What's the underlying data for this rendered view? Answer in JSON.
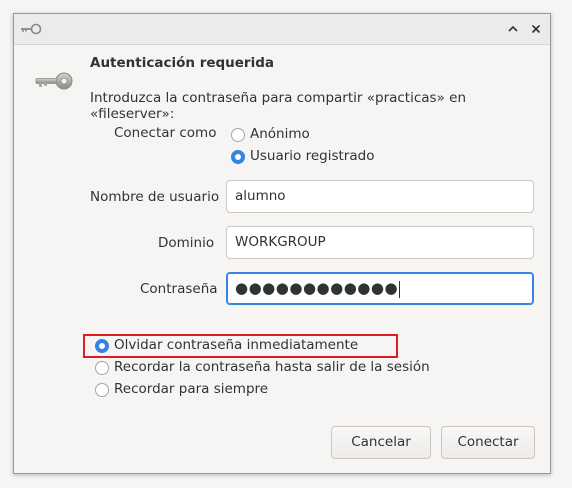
{
  "dialog": {
    "title": "Autenticación requerida",
    "description": "Introduzca la contraseña para compartir «practicas» en «fileserver»:"
  },
  "connect_as": {
    "label": "Conectar como",
    "options": [
      {
        "label": "Anónimo",
        "selected": false
      },
      {
        "label": "Usuario registrado",
        "selected": true
      }
    ]
  },
  "fields": {
    "username": {
      "label": "Nombre de usuario",
      "value": "alumno"
    },
    "domain": {
      "label": "Dominio",
      "value": "WORKGROUP"
    },
    "password": {
      "label": "Contraseña",
      "value": "●●●●●●●●●●●●"
    }
  },
  "remember": {
    "options": [
      {
        "label": "Olvidar contraseña inmediatamente",
        "selected": true
      },
      {
        "label": "Recordar la contraseña hasta salir de la sesión",
        "selected": false
      },
      {
        "label": "Recordar para siempre",
        "selected": false
      }
    ]
  },
  "buttons": {
    "cancel": "Cancelar",
    "connect": "Conectar"
  },
  "titlebar": {
    "minimize_icon": "chevron-up-icon",
    "close_icon": "close-icon"
  },
  "colors": {
    "accent": "#3584e4",
    "highlight": "#e01b24"
  }
}
